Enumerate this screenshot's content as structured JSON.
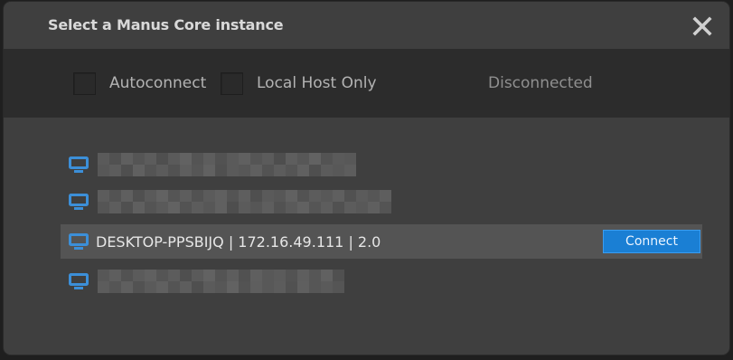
{
  "dialog": {
    "title": "Select a Manus Core instance",
    "close_icon": "close-icon"
  },
  "options": {
    "autoconnect_label": "Autoconnect",
    "local_host_only_label": "Local Host Only",
    "autoconnect_checked": false,
    "local_host_only_checked": false,
    "status": "Disconnected"
  },
  "instances": [
    {
      "label": "",
      "redacted": true,
      "icon": "monitor-icon"
    },
    {
      "label": "",
      "redacted": true,
      "icon": "monitor-icon"
    },
    {
      "label": "DESKTOP-PPSBIJQ | 172.16.49.111 | 2.0",
      "redacted": false,
      "selected": true,
      "icon": "monitor-icon",
      "connect_label": "Connect"
    },
    {
      "label": "",
      "redacted": true,
      "icon": "monitor-icon"
    }
  ],
  "colors": {
    "accent": "#1a7fd4",
    "icon_blue": "#3c8fd8",
    "dialog_bg": "#3f3f3f",
    "options_bg": "#2c2c2c",
    "selected_row_bg": "#545454"
  }
}
